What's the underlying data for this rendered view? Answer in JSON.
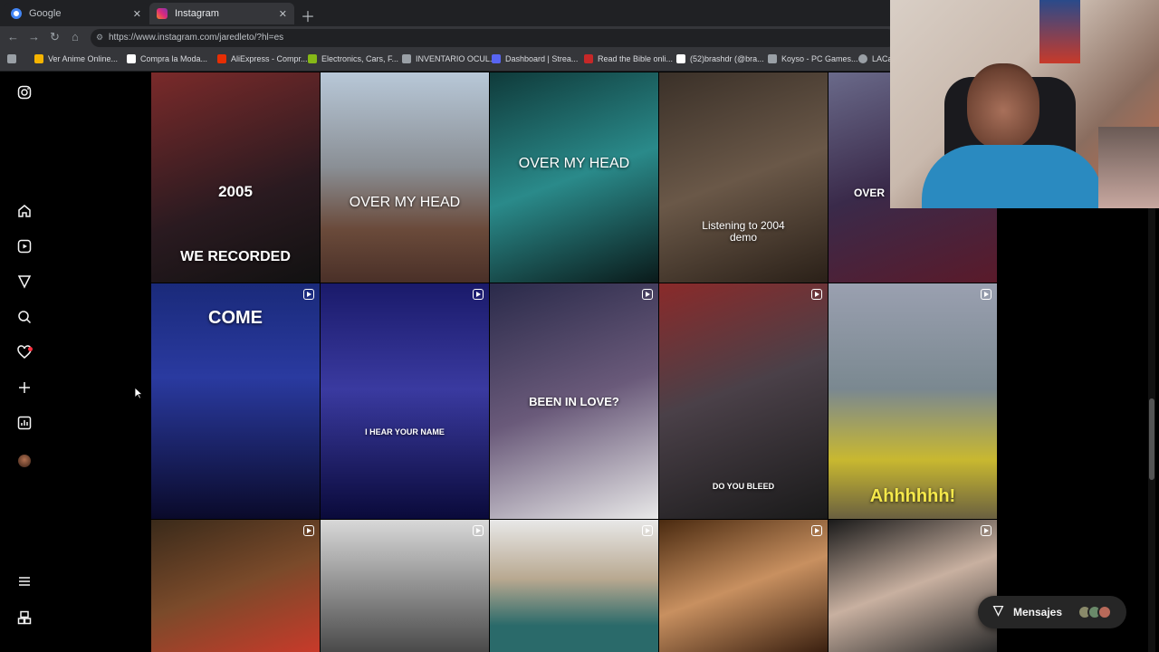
{
  "browser": {
    "tabs": [
      {
        "title": "Google",
        "active": false,
        "favicon_color": "#4285f4"
      },
      {
        "title": "Instagram",
        "active": true,
        "favicon_color": "#e1306c"
      }
    ],
    "url": "https://www.instagram.com/jaredleto/?hl=es",
    "bookmarks": [
      {
        "label": "Ver Anime Online...",
        "color": "#f5b400"
      },
      {
        "label": "Compra la Moda...",
        "color": "#ffffff"
      },
      {
        "label": "AliExpress - Compr...",
        "color": "#e62e04"
      },
      {
        "label": "Electronics, Cars, F...",
        "color": "#86b817"
      },
      {
        "label": "INVENTARIO OCUL...",
        "color": "#9aa0a6"
      },
      {
        "label": "Dashboard | Strea...",
        "color": "#5865f2"
      },
      {
        "label": "Read the Bible onli...",
        "color": "#c62828"
      },
      {
        "label": "(52)brashdr (@bra...",
        "color": "#ffffff"
      },
      {
        "label": "Koyso - PC Games...",
        "color": "#9aa0a6"
      },
      {
        "label": "LACar",
        "color": "#9aa0a6"
      }
    ]
  },
  "sidebar": {
    "icons": [
      "instagram-logo-icon",
      "home-icon",
      "reels-icon",
      "explore-icon",
      "search-icon",
      "heart-icon",
      "create-icon",
      "dashboard-icon",
      "profile-avatar",
      "menu-icon",
      "more-icon"
    ]
  },
  "grid": {
    "tiles": [
      {
        "caption": "2005",
        "caption2": "WE RECORDED",
        "reel": false,
        "bg": "linear-gradient(160deg,#7a2a2a,#2a1a20 60%,#111)"
      },
      {
        "caption": "OVER MY HEAD",
        "caption2": "",
        "reel": false,
        "bg": "linear-gradient(180deg,#b8c8d8,#8a8f95 45%,#6a4a3a 75%,#4a3028)"
      },
      {
        "caption": "OVER MY HEAD",
        "caption2": "",
        "reel": false,
        "bg": "linear-gradient(160deg,#0f3a3a,#2a8a8a 50%,#0a1a1a)"
      },
      {
        "caption": "Listening to 2004 demo",
        "caption2": "",
        "reel": false,
        "bg": "linear-gradient(160deg,#3a3028,#6a5848 50%,#2a2018)"
      },
      {
        "caption": "OVER",
        "caption2": "",
        "reel": false,
        "bg": "linear-gradient(160deg,#6a6a8a,#3a2a4a 50%,#5a1a2a)"
      },
      {
        "caption": "COME",
        "caption2": "",
        "reel": true,
        "bg": "linear-gradient(180deg,#1a2a7a,#2a3aa0 40%,#0a0a2a)"
      },
      {
        "caption": "I HEAR YOUR NAME",
        "caption2": "",
        "reel": true,
        "bg": "linear-gradient(180deg,#1a1a6a,#3a3aa0 45%,#0a0a3a)"
      },
      {
        "caption": "BEEN IN LOVE?",
        "caption2": "",
        "reel": true,
        "bg": "linear-gradient(160deg,#2a2a4a,#6a5a7a 50%,#e8e8e8)"
      },
      {
        "caption": "DO YOU BLEED",
        "caption2": "",
        "reel": true,
        "bg": "linear-gradient(160deg,#8a2a2a,#4a4048 45%,#1a1a1a)"
      },
      {
        "caption": "Ahhhhhh!",
        "caption2": "",
        "reel": true,
        "bg": "linear-gradient(180deg,#9aa0b0,#7a8890 45%,#c8b830 75%,#6a6040)"
      },
      {
        "caption": "",
        "caption2": "",
        "reel": true,
        "bg": "linear-gradient(160deg,#3a2a1a,#7a4a2a 50%,#c83a2a)"
      },
      {
        "caption": "",
        "caption2": "",
        "reel": true,
        "bg": "linear-gradient(180deg,#d8d8d8,#8a8a8a 55%,#4a4a4a)"
      },
      {
        "caption": "",
        "caption2": "",
        "reel": true,
        "bg": "linear-gradient(180deg,#e8e8e8,#b8a890 45%,#2a6a6a 80%)"
      },
      {
        "caption": "",
        "caption2": "",
        "reel": true,
        "bg": "linear-gradient(160deg,#4a2a10,#c89060 50%,#3a2010)"
      },
      {
        "caption": "",
        "caption2": "",
        "reel": true,
        "bg": "linear-gradient(160deg,#1a1a1a,#c8b0a0 50%,#2a2a2a)"
      }
    ]
  },
  "messages": {
    "label": "Mensajes"
  }
}
